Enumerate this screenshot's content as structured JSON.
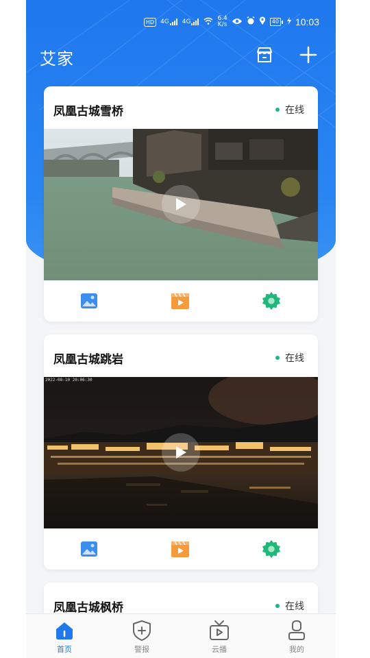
{
  "status_bar": {
    "hd_badge": "HD",
    "signal_1": "4G",
    "signal_2": "4G",
    "speed_value": "6.4",
    "speed_unit": "K/s",
    "battery": "40",
    "time": "10:03"
  },
  "header": {
    "title": "艾家"
  },
  "cameras": [
    {
      "name": "凤凰古城雪桥",
      "status": "在线"
    },
    {
      "name": "凤凰古城跳岩",
      "status": "在线",
      "timestamp": "2022-08-10 20:06:30"
    },
    {
      "name": "凤凰古城枫桥",
      "status": "在线"
    }
  ],
  "tabbar": {
    "items": [
      {
        "label": "首页",
        "icon": "home-icon",
        "active": true
      },
      {
        "label": "警报",
        "icon": "shield-plus-icon",
        "active": false
      },
      {
        "label": "云播",
        "icon": "tv-play-icon",
        "active": false
      },
      {
        "label": "我的",
        "icon": "profile-icon",
        "active": false
      }
    ]
  },
  "colors": {
    "brand_blue": "#1f78ee",
    "online_green": "#1fb77a",
    "photo_icon": "#3b8ef0",
    "video_icon": "#f59b3c",
    "settings_icon": "#1fb77a"
  }
}
